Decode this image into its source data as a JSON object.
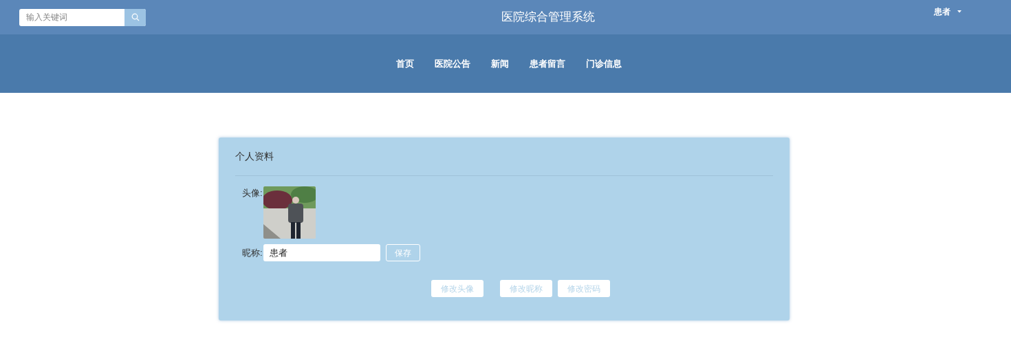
{
  "search": {
    "placeholder": "输入关键词"
  },
  "site_title": "医院综合管理系统",
  "user_menu": {
    "label": "患者"
  },
  "nav": [
    {
      "label": "首页"
    },
    {
      "label": "医院公告"
    },
    {
      "label": "新闻"
    },
    {
      "label": "患者留言"
    },
    {
      "label": "门诊信息"
    }
  ],
  "profile": {
    "title": "个人资料",
    "avatar_label": "头像:",
    "nickname_label": "昵称:",
    "nickname_value": "患者",
    "save_button": "保存",
    "actions": [
      {
        "label": "修改头像"
      },
      {
        "label": "修改昵称"
      },
      {
        "label": "修改密码"
      }
    ]
  }
}
